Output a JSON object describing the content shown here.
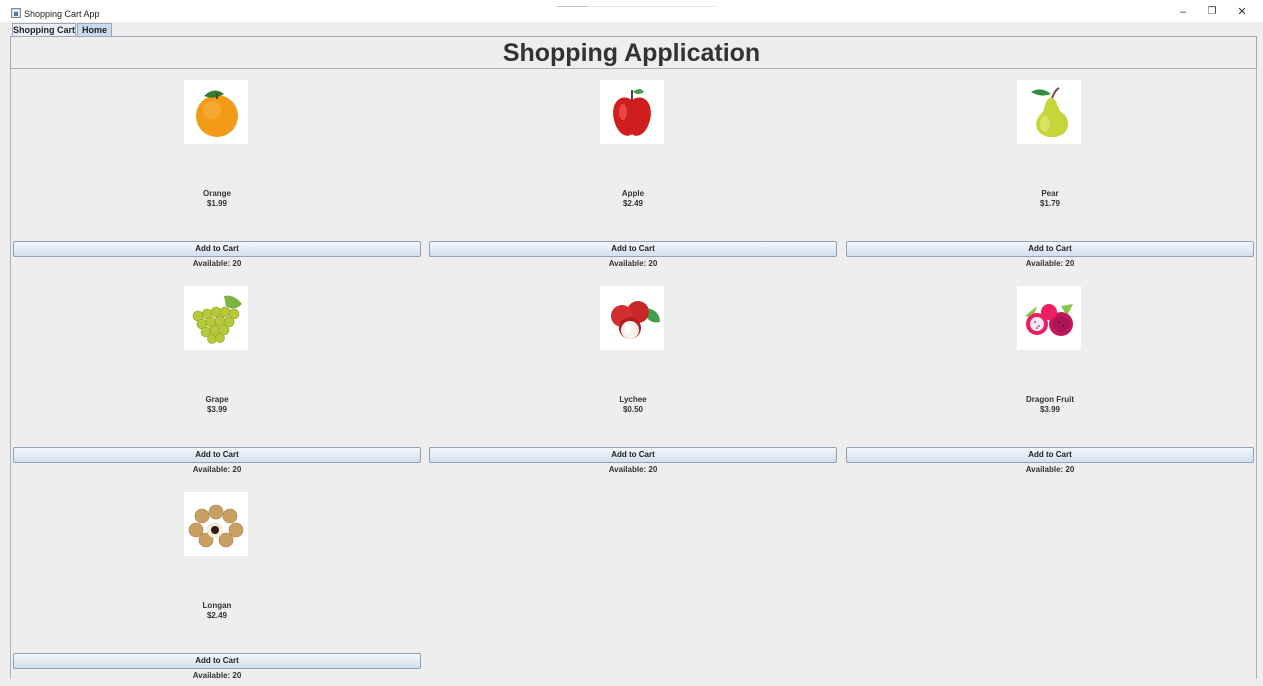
{
  "window": {
    "title": "Shopping Cart App",
    "controls": {
      "minimize": "–",
      "maximize": "❐",
      "close": "✕"
    }
  },
  "tabs": [
    {
      "label": "Shopping Cart"
    },
    {
      "label": "Home",
      "selected": true
    }
  ],
  "page_title": "Shopping Application",
  "button_label": "Add to Cart",
  "products": [
    {
      "name": "Orange",
      "price": "$1.99",
      "availability": "Available: 20",
      "icon": "orange-icon"
    },
    {
      "name": "Apple",
      "price": "$2.49",
      "availability": "Available: 20",
      "icon": "apple-icon"
    },
    {
      "name": "Pear",
      "price": "$1.79",
      "availability": "Available: 20",
      "icon": "pear-icon"
    },
    {
      "name": "Grape",
      "price": "$3.99",
      "availability": "Available: 20",
      "icon": "grape-icon"
    },
    {
      "name": "Lychee",
      "price": "$0.50",
      "availability": "Available: 20",
      "icon": "lychee-icon"
    },
    {
      "name": "Dragon Fruit",
      "price": "$3.99",
      "availability": "Available: 20",
      "icon": "dragon-fruit-icon"
    },
    {
      "name": "Longan",
      "price": "$2.49",
      "availability": "Available: 20",
      "icon": "longan-icon"
    }
  ],
  "colors": {
    "background": "#eeeeee",
    "button_top": "#f4f7fb",
    "button_bottom": "#d3dfee",
    "selected_tab": "#c9dbee"
  }
}
